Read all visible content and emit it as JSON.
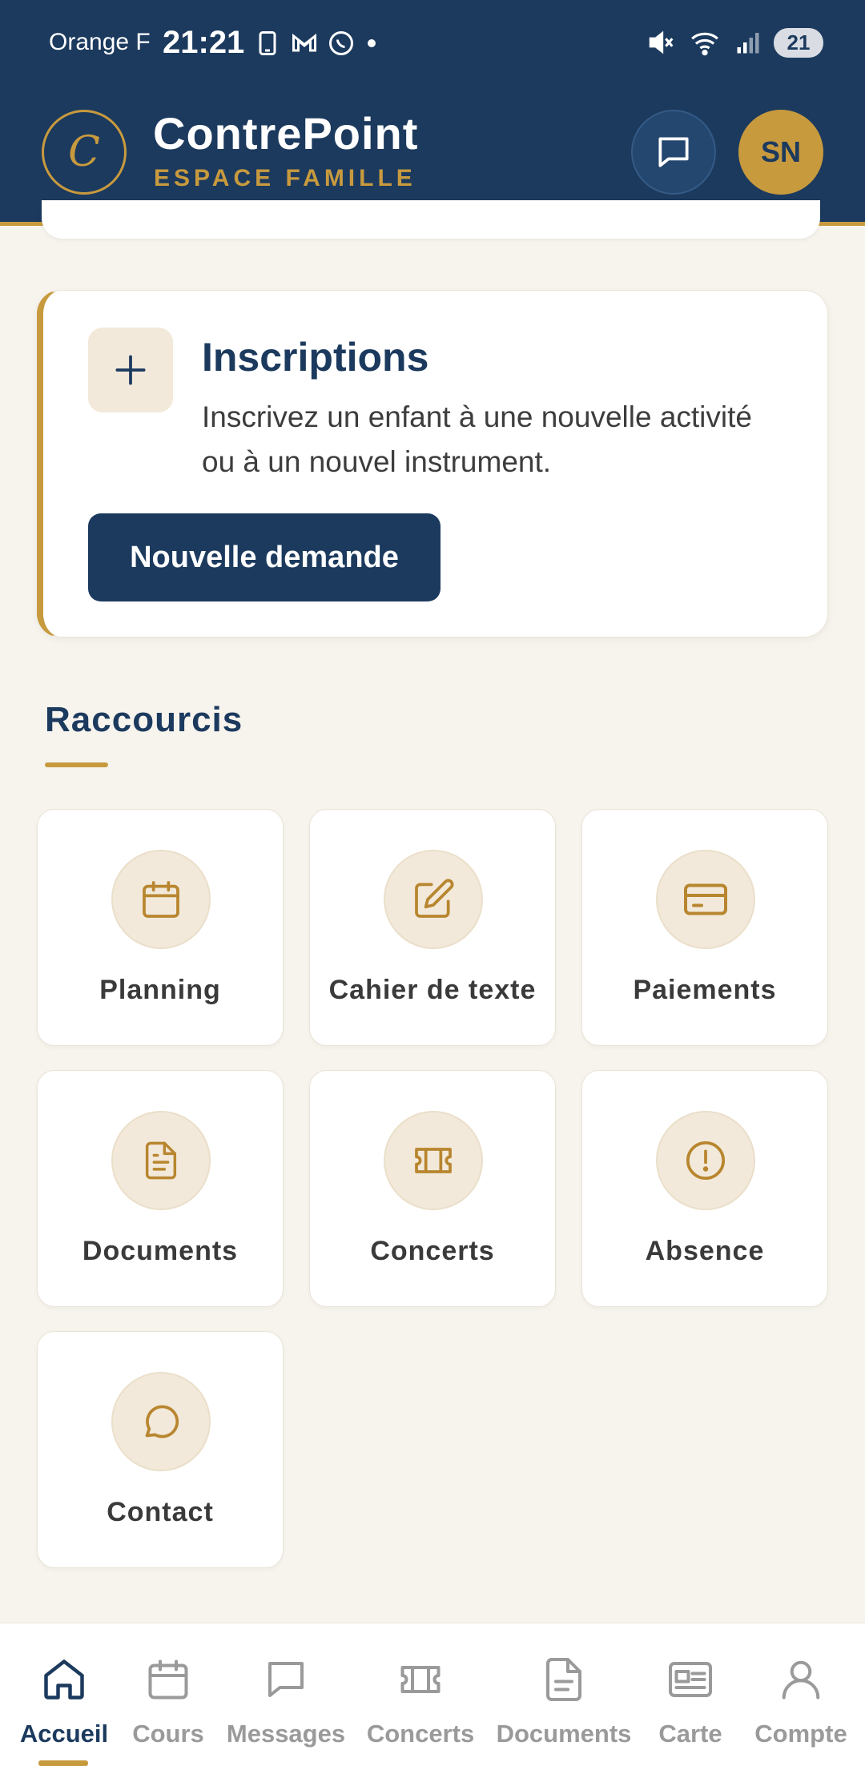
{
  "status_bar": {
    "carrier": "Orange F",
    "time": "21:21",
    "battery": "21"
  },
  "header": {
    "logo_letter": "C",
    "app_name": "ContrePoint",
    "app_subtitle": "ESPACE FAMILLE",
    "avatar_initials": "SN"
  },
  "inscriptions": {
    "title": "Inscriptions",
    "description": "Inscrivez un enfant à une nouvelle activité ou à un nouvel instrument.",
    "button_label": "Nouvelle demande"
  },
  "shortcuts": {
    "title": "Raccourcis",
    "items": [
      {
        "label": "Planning",
        "icon": "calendar-icon"
      },
      {
        "label": "Cahier de texte",
        "icon": "edit-icon"
      },
      {
        "label": "Paiements",
        "icon": "credit-card-icon"
      },
      {
        "label": "Documents",
        "icon": "document-icon"
      },
      {
        "label": "Concerts",
        "icon": "ticket-icon"
      },
      {
        "label": "Absence",
        "icon": "alert-circle-icon"
      },
      {
        "label": "Contact",
        "icon": "chat-bubble-icon"
      }
    ]
  },
  "bottom_nav": {
    "active": "Accueil",
    "items": [
      {
        "label": "Accueil",
        "icon": "home-icon"
      },
      {
        "label": "Cours",
        "icon": "calendar-icon"
      },
      {
        "label": "Messages",
        "icon": "message-icon"
      },
      {
        "label": "Concerts",
        "icon": "ticket-icon"
      },
      {
        "label": "Documents",
        "icon": "document-icon"
      },
      {
        "label": "Carte",
        "icon": "id-card-icon"
      },
      {
        "label": "Compte",
        "icon": "user-icon"
      }
    ]
  },
  "colors": {
    "primary": "#1c3a5e",
    "accent": "#c89a3e",
    "background": "#f7f4ee",
    "icon_bg": "#f2e9da"
  }
}
